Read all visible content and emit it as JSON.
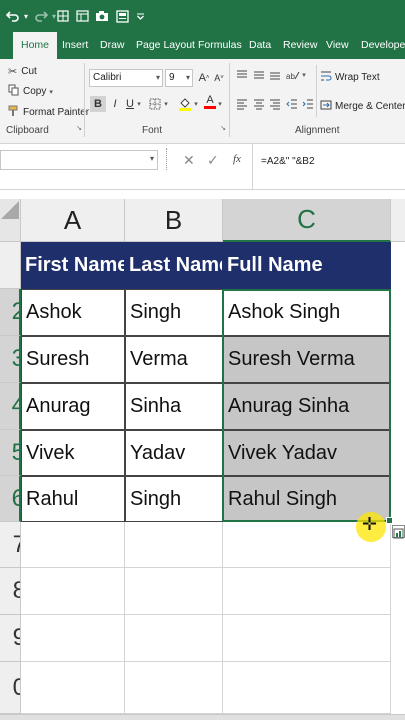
{
  "quick_access": {
    "undo_icon": "undo-icon",
    "redo_icon": "redo-icon",
    "customize_icon": "chevron-down-icon"
  },
  "ribbon": {
    "tabs": [
      "Home",
      "Insert",
      "Draw",
      "Page Layout",
      "Formulas",
      "Data",
      "Review",
      "View",
      "Developer"
    ],
    "active_tab": "Home",
    "clipboard": {
      "cut": "Cut",
      "copy": "Copy",
      "format_painter": "Format Painter",
      "group_label": "Clipboard"
    },
    "font": {
      "font_name": "Calibri",
      "font_size": "9",
      "bold": "B",
      "italic": "I",
      "underline": "U",
      "grow": "A",
      "shrink": "A",
      "font_color": "A",
      "group_label": "Font"
    },
    "alignment": {
      "wrap_text": "Wrap Text",
      "merge_center": "Merge & Center",
      "group_label": "Alignment"
    }
  },
  "formula_bar": {
    "fx_label": "fx",
    "formula": "=A2&\" \"&B2"
  },
  "grid": {
    "columns": [
      "A",
      "B",
      "C"
    ],
    "selected_column": "C",
    "row_numbers": [
      "",
      "2",
      "3",
      "4",
      "5",
      "6",
      "7",
      "8",
      "9",
      "0"
    ],
    "header": [
      "First Name",
      "Last Name",
      "Full Name"
    ],
    "rows": [
      [
        "Ashok",
        "Singh",
        "Ashok Singh"
      ],
      [
        "Suresh",
        "Verma",
        "Suresh Verma"
      ],
      [
        "Anurag",
        "Sinha",
        "Anurag Sinha"
      ],
      [
        "Vivek",
        "Yadav",
        "Vivek  Yadav"
      ],
      [
        "Rahul",
        "Singh",
        "Rahul Singh"
      ]
    ]
  },
  "colors": {
    "excel_green": "#217346",
    "header_fill": "#1f2f6b",
    "selection_fill": "#c6c6c6"
  }
}
